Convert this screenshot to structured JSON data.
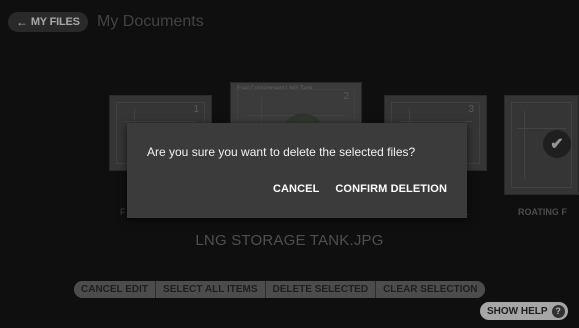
{
  "header": {
    "back_label": "MY FILES",
    "back_arrow": "←",
    "title": "My Documents"
  },
  "carousel": {
    "items": [
      {
        "num": "1"
      },
      {
        "num": "2",
        "title": "Fuel Containment LNG Tank"
      },
      {
        "num": "3"
      },
      {
        "check": "✔"
      }
    ],
    "label_left": "F",
    "label_dot": ".",
    "label_right": "ROATING F"
  },
  "current_file": "LNG STORAGE TANK.JPG",
  "toolbar": {
    "cancel_edit": "CANCEL EDIT",
    "select_all": "SELECT ALL ITEMS",
    "delete_selected": "DELETE SELECTED",
    "clear_selection": "CLEAR SELECTION"
  },
  "help": {
    "label": "SHOW HELP",
    "icon": "?"
  },
  "dialog": {
    "message": "Are you sure you want to delete the selected files?",
    "cancel": "CANCEL",
    "confirm": "CONFIRM DELETION"
  }
}
